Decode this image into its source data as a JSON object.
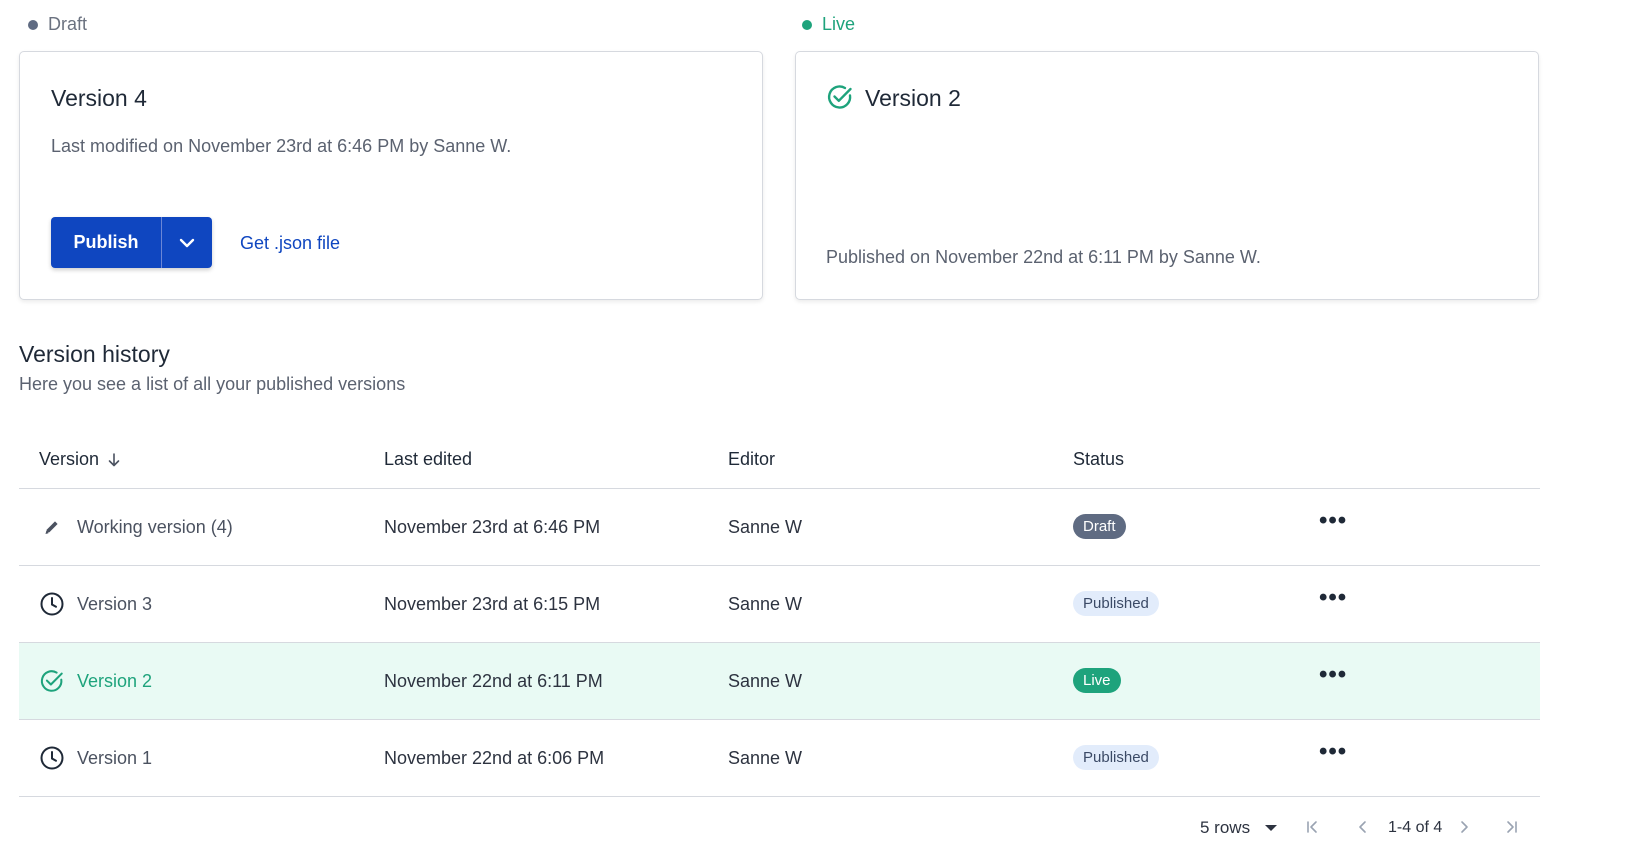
{
  "draft_section": {
    "label": "Draft",
    "card": {
      "title": "Version 4",
      "meta": "Last modified on November 23rd at 6:46 PM by Sanne W.",
      "publish_label": "Publish",
      "json_link": "Get .json file"
    }
  },
  "live_section": {
    "label": "Live",
    "card": {
      "title": "Version 2",
      "meta": "Published on November 22nd at 6:11 PM by Sanne W."
    }
  },
  "history": {
    "title": "Version history",
    "subtitle": "Here you see a list of all your published versions",
    "columns": {
      "version": "Version",
      "last_edited": "Last edited",
      "editor": "Editor",
      "status": "Status"
    },
    "rows": [
      {
        "version": "Working version (4)",
        "last_edited": "November 23rd at 6:46 PM",
        "editor": "Sanne W",
        "status": "Draft",
        "icon": "pencil-icon"
      },
      {
        "version": "Version 3",
        "last_edited": "November 23rd at 6:15 PM",
        "editor": "Sanne W",
        "status": "Published",
        "icon": "clock-icon"
      },
      {
        "version": "Version 2",
        "last_edited": "November 22nd at 6:11 PM",
        "editor": "Sanne W",
        "status": "Live",
        "icon": "check-circle-icon"
      },
      {
        "version": "Version 1",
        "last_edited": "November 22nd at 6:06 PM",
        "editor": "Sanne W",
        "status": "Published",
        "icon": "clock-icon"
      }
    ],
    "more_label": "•••"
  },
  "pagination": {
    "rows_label": "5 rows",
    "range": "1-4 of 4"
  },
  "colors": {
    "primary": "#0f46c0",
    "live": "#1ea37c",
    "draft": "#5f6b82",
    "published_badge_bg": "#e2ecfb",
    "live_row_bg": "#e9faf4"
  }
}
